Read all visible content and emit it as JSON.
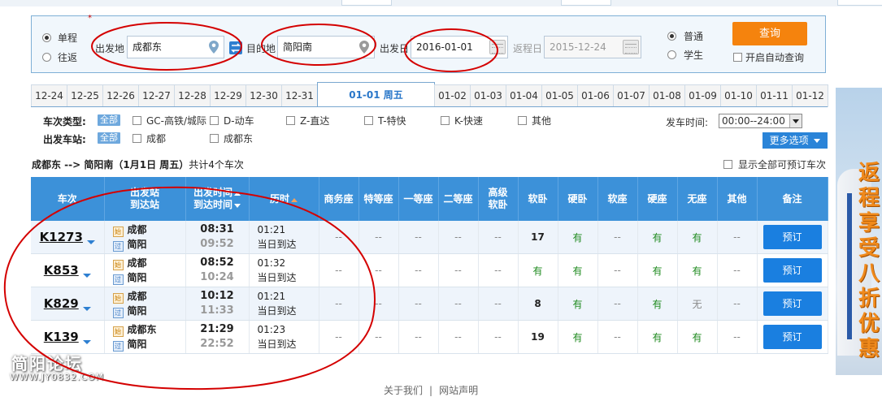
{
  "search": {
    "trip_types": [
      "单程",
      "往返"
    ],
    "from_label": "出发地",
    "from_value": "成都东",
    "to_label": "目的地",
    "to_value": "简阳南",
    "date_label": "出发日",
    "date_value": "2016-01-01",
    "return_label": "返程日",
    "return_value": "2015-12-24",
    "passenger_types": [
      "普通",
      "学生"
    ],
    "query_label": "查询",
    "auto_query_label": "开启自动查询"
  },
  "date_tabs": [
    "12-24",
    "12-25",
    "12-26",
    "12-27",
    "12-28",
    "12-29",
    "12-30",
    "12-31",
    "01-01 周五",
    "01-02",
    "01-03",
    "01-04",
    "01-05",
    "01-06",
    "01-07",
    "01-08",
    "01-09",
    "01-10",
    "01-11",
    "01-12"
  ],
  "filters": {
    "train_type_label": "车次类型:",
    "all_label": "全部",
    "train_types": [
      "GC-高铁/城际",
      "D-动车",
      "Z-直达",
      "T-特快",
      "K-快速",
      "其他"
    ],
    "station_label": "出发车站:",
    "stations": [
      "成都",
      "成都东"
    ],
    "depart_time_label": "发车时间:",
    "depart_time_value": "00:00--24:00",
    "more_options_label": "更多选项"
  },
  "summary": {
    "route": "成都东 --> 简阳南",
    "date_text": "（1月1日  周五）",
    "count_text": "共计4个车次",
    "show_all_label": "显示全部可预订车次"
  },
  "table": {
    "headers": {
      "train": "车次",
      "stations_1": "出发站",
      "stations_2": "到达站",
      "times_1": "出发时间",
      "times_2": "到达时间",
      "duration": "历时",
      "business": "商务座",
      "special": "特等座",
      "first": "一等座",
      "second": "二等座",
      "senior_1": "高级",
      "senior_2": "软卧",
      "soft_sleeper": "软卧",
      "hard_sleeper": "硬卧",
      "soft_seat": "软座",
      "hard_seat": "硬座",
      "no_seat": "无座",
      "other": "其他",
      "remark": "备注"
    },
    "start_badge": "始",
    "pass_badge": "过",
    "rows": [
      {
        "train": "K1273",
        "from": "成都",
        "to": "简阳",
        "dep": "08:31",
        "arr": "09:52",
        "duration": "01:21",
        "arrive_note": "当日到达",
        "business": "--",
        "special": "--",
        "first": "--",
        "second": "--",
        "senior": "--",
        "soft_sleeper": "17",
        "hard_sleeper": "有",
        "soft_seat": "--",
        "hard_seat": "有",
        "no_seat": "有",
        "other": "--",
        "book": "预订"
      },
      {
        "train": "K853",
        "from": "成都",
        "to": "简阳",
        "dep": "08:52",
        "arr": "10:24",
        "duration": "01:32",
        "arrive_note": "当日到达",
        "business": "--",
        "special": "--",
        "first": "--",
        "second": "--",
        "senior": "--",
        "soft_sleeper": "有",
        "hard_sleeper": "有",
        "soft_seat": "--",
        "hard_seat": "有",
        "no_seat": "有",
        "other": "--",
        "book": "预订"
      },
      {
        "train": "K829",
        "from": "成都",
        "to": "简阳",
        "dep": "10:12",
        "arr": "11:33",
        "duration": "01:21",
        "arrive_note": "当日到达",
        "business": "--",
        "special": "--",
        "first": "--",
        "second": "--",
        "senior": "--",
        "soft_sleeper": "8",
        "hard_sleeper": "有",
        "soft_seat": "--",
        "hard_seat": "有",
        "no_seat": "无",
        "other": "--",
        "book": "预订"
      },
      {
        "train": "K139",
        "from": "成都东",
        "to": "简阳",
        "dep": "21:29",
        "arr": "22:52",
        "duration": "01:23",
        "arrive_note": "当日到达",
        "business": "--",
        "special": "--",
        "first": "--",
        "second": "--",
        "senior": "--",
        "soft_sleeper": "19",
        "hard_sleeper": "有",
        "soft_seat": "--",
        "hard_seat": "有",
        "no_seat": "有",
        "other": "--",
        "book": "预订"
      }
    ]
  },
  "ad": {
    "text": "返程享受八折优惠"
  },
  "watermark": {
    "title": "简阳论坛",
    "url": "WWW.JY0832.COM"
  },
  "footer": {
    "about": "关于我们",
    "sep": "|",
    "statement": "网站声明"
  },
  "colors": {
    "accent": "#3c91d9",
    "query": "#f5830d",
    "book": "#1a7fe0",
    "have": "#1e8a1e",
    "annotation": "#d40000"
  }
}
